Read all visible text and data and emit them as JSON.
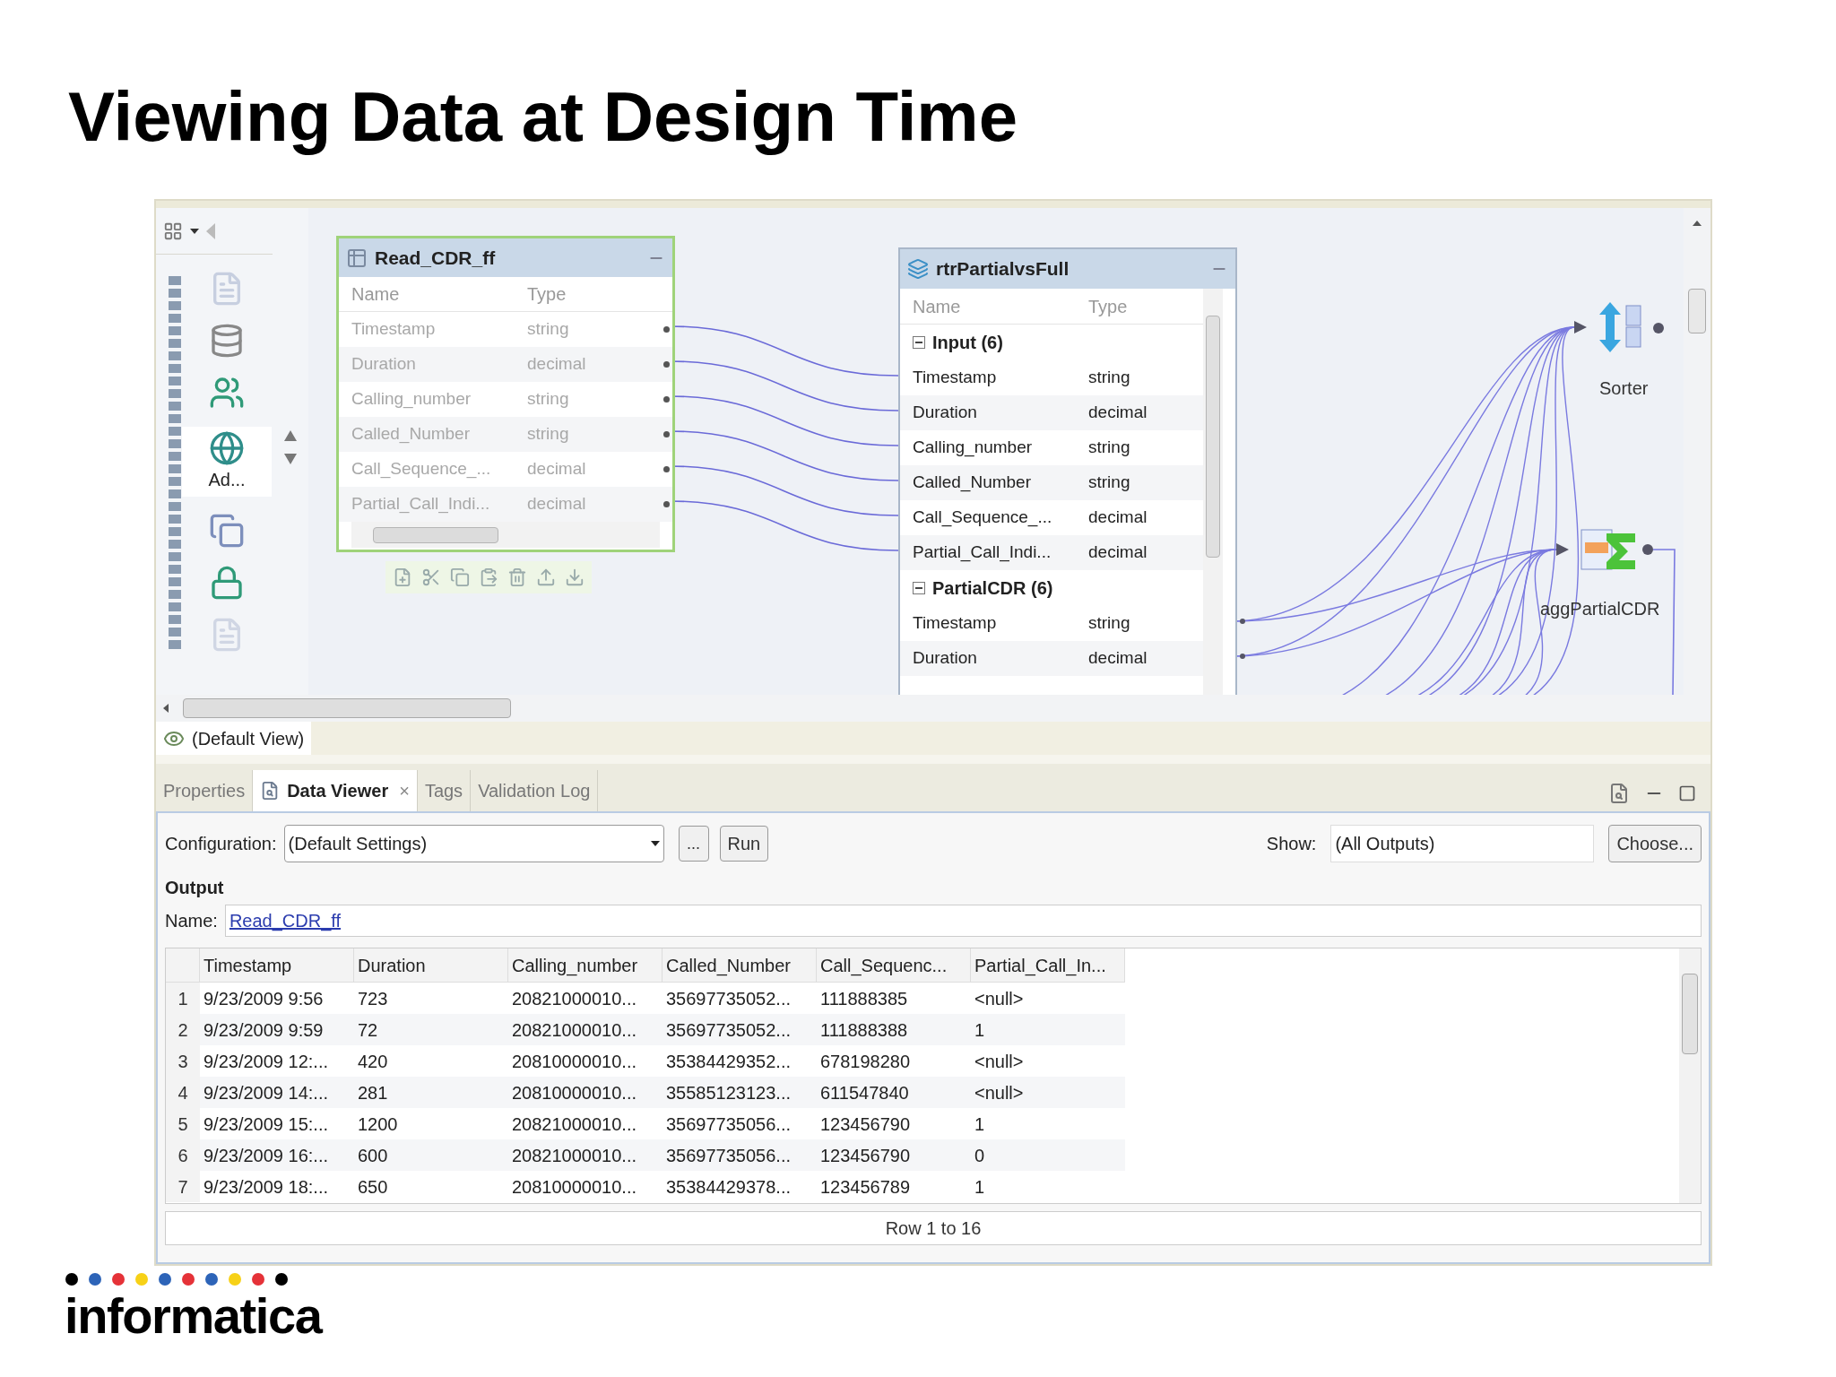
{
  "title": "Viewing Data at Design Time",
  "editor": {
    "palette": {
      "item_label": "Ad..."
    },
    "nodes": [
      {
        "kind": "table",
        "title": "Read_CDR_ff",
        "selected": true,
        "columns": [
          "Name",
          "Type"
        ],
        "rows": [
          {
            "name": "Timestamp",
            "type": "string"
          },
          {
            "name": "Duration",
            "type": "decimal"
          },
          {
            "name": "Calling_number",
            "type": "string"
          },
          {
            "name": "Called_Number",
            "type": "string"
          },
          {
            "name": "Call_Sequence_...",
            "type": "decimal"
          },
          {
            "name": "Partial_Call_Indi...",
            "type": "decimal"
          }
        ]
      },
      {
        "kind": "grouped",
        "title": "rtrPartialvsFull",
        "selected": false,
        "columns": [
          "Name",
          "Type"
        ],
        "groups": [
          {
            "label": "Input (6)",
            "expanded": true,
            "rows": [
              {
                "name": "Timestamp",
                "type": "string"
              },
              {
                "name": "Duration",
                "type": "decimal"
              },
              {
                "name": "Calling_number",
                "type": "string"
              },
              {
                "name": "Called_Number",
                "type": "string"
              },
              {
                "name": "Call_Sequence_...",
                "type": "decimal"
              },
              {
                "name": "Partial_Call_Indi...",
                "type": "decimal"
              }
            ]
          },
          {
            "label": "PartialCDR (6)",
            "expanded": true,
            "rows": [
              {
                "name": "Timestamp",
                "type": "string"
              },
              {
                "name": "Duration",
                "type": "decimal"
              }
            ]
          }
        ]
      }
    ],
    "icon_nodes": [
      {
        "kind": "sorter",
        "label": "Sorter"
      },
      {
        "kind": "aggregator",
        "label": "aggPartialCDR"
      }
    ],
    "view_label": "(Default View)"
  },
  "panel": {
    "tabs": [
      {
        "label": "Properties",
        "selected": false
      },
      {
        "label": "Data Viewer",
        "selected": true,
        "close_glyph": "×"
      },
      {
        "label": "Tags",
        "selected": false
      },
      {
        "label": "Validation Log",
        "selected": false
      }
    ],
    "configuration": {
      "label": "Configuration:",
      "value": "(Default Settings)"
    },
    "more_button": "...",
    "run_button": "Run",
    "show": {
      "label": "Show:",
      "value": "(All Outputs)"
    },
    "choose_button": "Choose...",
    "output": {
      "heading": "Output",
      "name_label": "Name:",
      "name_link": "Read_CDR_ff"
    },
    "table": {
      "columns": [
        "Timestamp",
        "Duration",
        "Calling_number",
        "Called_Number",
        "Call_Sequenc...",
        "Partial_Call_In..."
      ],
      "rows": [
        {
          "number": "1",
          "cells": [
            "9/23/2009 9:56",
            "723",
            "20821000010...",
            "35697735052...",
            "111888385",
            "<null>"
          ]
        },
        {
          "number": "2",
          "cells": [
            "9/23/2009 9:59",
            "72",
            "20821000010...",
            "35697735052...",
            "111888388",
            "1"
          ]
        },
        {
          "number": "3",
          "cells": [
            "9/23/2009 12:...",
            "420",
            "20810000010...",
            "35384429352...",
            "678198280",
            "<null>"
          ]
        },
        {
          "number": "4",
          "cells": [
            "9/23/2009 14:...",
            "281",
            "20810000010...",
            "35585123123...",
            "611547840",
            "<null>"
          ]
        },
        {
          "number": "5",
          "cells": [
            "9/23/2009 15:...",
            "1200",
            "20821000010...",
            "35697735056...",
            "123456790",
            "1"
          ]
        },
        {
          "number": "6",
          "cells": [
            "9/23/2009 16:...",
            "600",
            "20821000010...",
            "35697735056...",
            "123456790",
            "0"
          ]
        },
        {
          "number": "7",
          "cells": [
            "9/23/2009 18:...",
            "650",
            "20810000010...",
            "35384429378...",
            "123456789",
            "1"
          ]
        }
      ]
    },
    "status": "Row 1 to 16"
  },
  "logo": {
    "text": "informatica"
  }
}
